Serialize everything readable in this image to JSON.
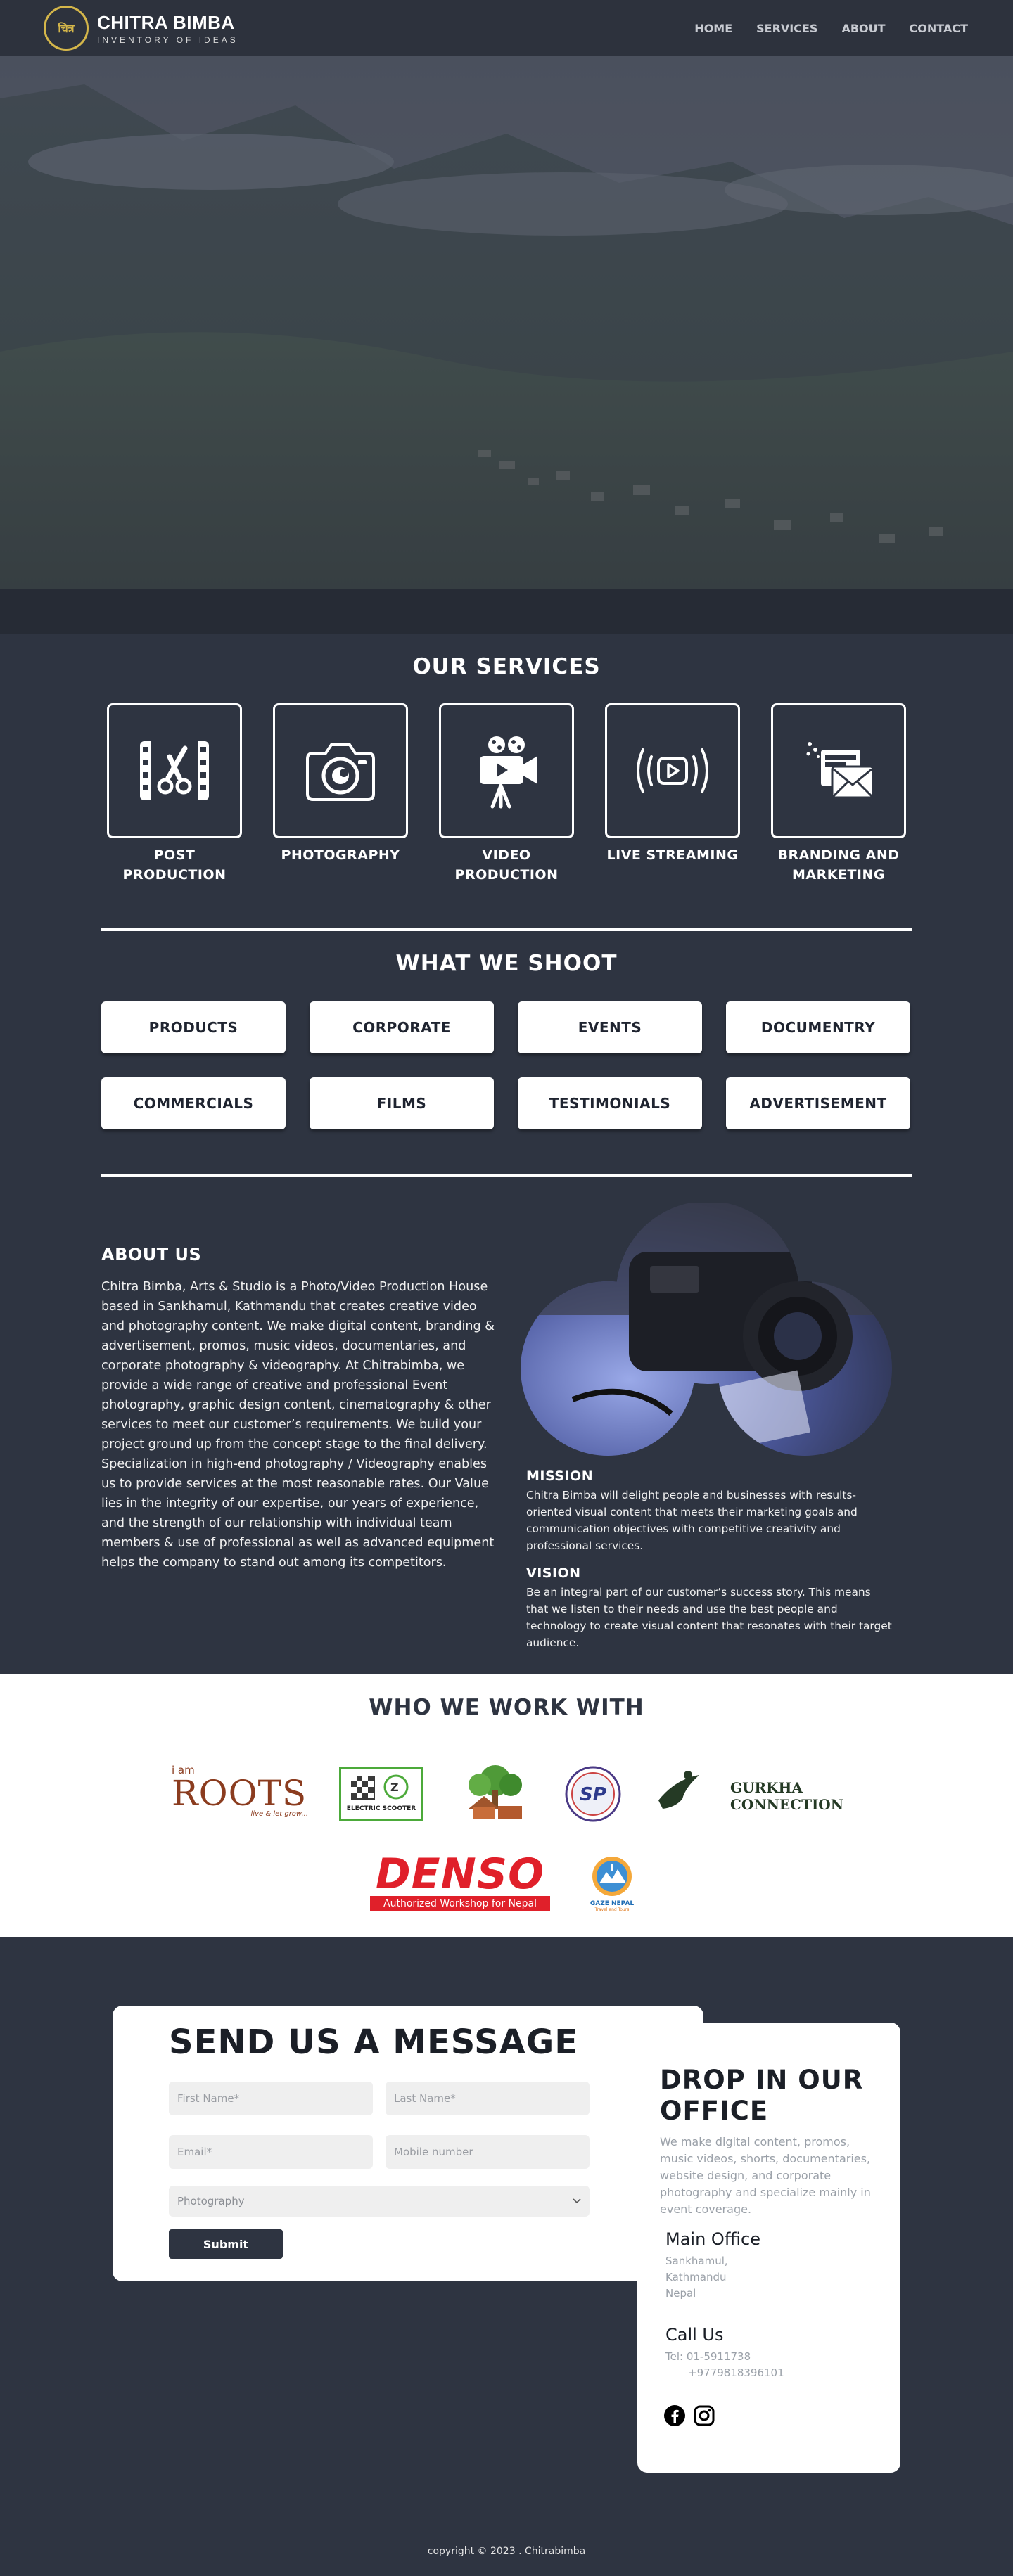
{
  "nav": {
    "logo_title": "CHITRA BIMBA",
    "logo_subtitle": "INVENTORY OF IDEAS",
    "logo_mark": "चित्र",
    "items": [
      "HOME",
      "SERVICES",
      "ABOUT",
      "CONTACT"
    ]
  },
  "services": {
    "title": "OUR SERVICES",
    "items": [
      {
        "label": "POST PRODUCTION",
        "icon": "film-cut-icon"
      },
      {
        "label": "PHOTOGRAPHY",
        "icon": "camera-icon"
      },
      {
        "label": "VIDEO PRODUCTION",
        "icon": "video-camera-icon"
      },
      {
        "label": "LIVE STREAMING",
        "icon": "live-stream-icon"
      },
      {
        "label": "BRANDING AND MARKETING",
        "icon": "branding-mail-icon"
      }
    ]
  },
  "shoot": {
    "title": "WHAT WE SHOOT",
    "items": [
      "PRODUCTS",
      "CORPORATE",
      "EVENTS",
      "DOCUMENTRY",
      "COMMERCIALS",
      "FILMS",
      "TESTIMONIALS",
      "ADVERTISEMENT"
    ]
  },
  "about": {
    "title": "ABOUT US",
    "body": "Chitra Bimba, Arts & Studio is a Photo/Video Production House based in Sankhamul, Kathmandu that creates creative video and photography content. We make digital content, branding & advertisement, promos, music videos, documentaries, and corporate photography & videography. At Chitrabimba, we provide a wide range of creative and professional Event photography, graphic design content, cinematography & other services to meet our customer’s requirements. We build your project ground up from the concept stage to the final delivery. Specialization in high-end photography / Videography enables us to provide services at the most reasonable rates. Our Value lies in the integrity of our expertise, our years of experience, and the strength of our relationship with individual team members & use of professional as well as advanced equipment helps the company to stand out among its competitors.",
    "mission_title": "MISSION",
    "mission": "Chitra Bimba will delight people and businesses with results-oriented visual content that meets their marketing goals and communication objectives with competitive creativity and professional services.",
    "vision_title": "VISION",
    "vision": "Be an integral part of our customer’s success story. This means that we listen to their needs and use the best people and technology to create visual content that resonates with their target audience."
  },
  "partners": {
    "title": "WHO WE WORK WITH",
    "roots": {
      "small": "i am",
      "big": "ROOTS",
      "tag": "live & let grow..."
    },
    "scooter": {
      "label": "ELECTRIC SCOOTER"
    },
    "gurkha": {
      "line1": "GURKHA",
      "line2": "CONNECTION"
    },
    "sp": {
      "label": "SP"
    },
    "denso": {
      "name": "DENSO",
      "sub": "Authorized Workshop for Nepal"
    },
    "gaze": {
      "name": "GAZE NEPAL",
      "tag": "Travel and Tours"
    }
  },
  "contact": {
    "form_title": "SEND US A MESSAGE",
    "first_name_placeholder": "First Name*",
    "last_name_placeholder": "Last Name*",
    "email_placeholder": "Email*",
    "mobile_placeholder": "Mobile number",
    "service_selected": "Photography",
    "submit": "Submit",
    "office_title": "DROP IN OUR OFFICE",
    "office_lead": "We make digital content, promos, music videos, shorts, documentaries, website design, and corporate photography and specialize mainly in event coverage.",
    "main_office_title": "Main Office",
    "address_1": "Sankhamul,",
    "address_2": "Kathmandu",
    "address_3": "Nepal",
    "call_title": "Call Us",
    "tel": "Tel: 01-5911738",
    "mobile": "+9779818396101"
  },
  "footer": {
    "copyright": "copyright © 2023 . Chitrabimba"
  },
  "colors": {
    "background": "#2e3441",
    "accent_gold": "#d4b64a",
    "white": "#ffffff"
  }
}
